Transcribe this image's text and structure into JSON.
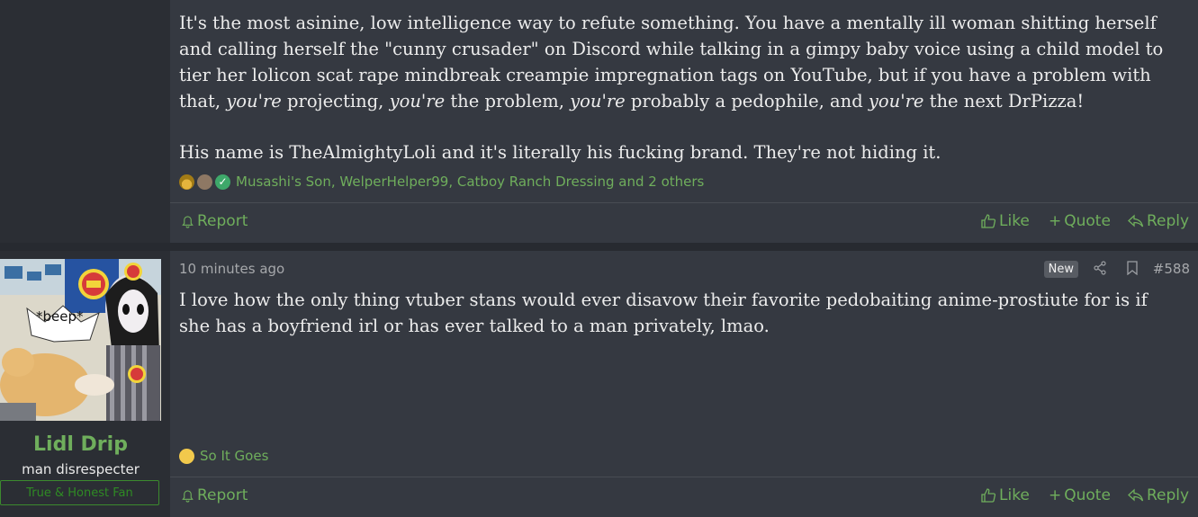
{
  "post1": {
    "paragraph1": [
      {
        "t": "It's the most asinine, low intelligence way to refute something. You have a mentally ill woman shitting herself and calling herself the \"cunny crusader\" on Discord while talking in a gimpy baby voice using a child model to tier her lolicon scat rape mindbreak creampie impregnation tags on YouTube, but if you have a problem with that, ",
        "i": false
      },
      {
        "t": "you're",
        "i": true
      },
      {
        "t": " projecting, ",
        "i": false
      },
      {
        "t": "you're",
        "i": true
      },
      {
        "t": " the problem, ",
        "i": false
      },
      {
        "t": "you're",
        "i": true
      },
      {
        "t": " probably a pedophile, and ",
        "i": false
      },
      {
        "t": "you're",
        "i": true
      },
      {
        "t": " the next DrPizza!",
        "i": false
      }
    ],
    "paragraph2": "His name is TheAlmightyLoli and it's literally his fucking brand. They're not hiding it.",
    "reactions": {
      "icons": [
        "medal-icon",
        "monkey-icon",
        "checkmark-icon"
      ],
      "names": "Musashi's Son, WelperHelper99, Catboy Ranch Dressing and 2 others"
    },
    "actions": {
      "report": "Report",
      "like": "Like",
      "quote": "Quote",
      "reply": "Reply"
    }
  },
  "post2": {
    "author": {
      "name": "Lidl Drip",
      "title": "man disrespecter",
      "banner": "True & Honest Fan",
      "avatar_text": "*beep*"
    },
    "time": "10 minutes ago",
    "badge": "New",
    "number": "#588",
    "body": "I love how the only thing vtuber stans would ever disavow their favorite pedobaiting anime-prostiute for is if she has a boyfriend irl or has ever talked to a man privately, lmao.",
    "reactions": {
      "icons": [
        "thinking-face-icon"
      ],
      "names": "So It Goes"
    },
    "actions": {
      "report": "Report",
      "like": "Like",
      "quote": "Quote",
      "reply": "Reply"
    }
  },
  "colors": {
    "accent": "#6fae5c",
    "background": "#272a30",
    "post_bg": "#353941",
    "sidebar_bg": "#2b2e34"
  }
}
